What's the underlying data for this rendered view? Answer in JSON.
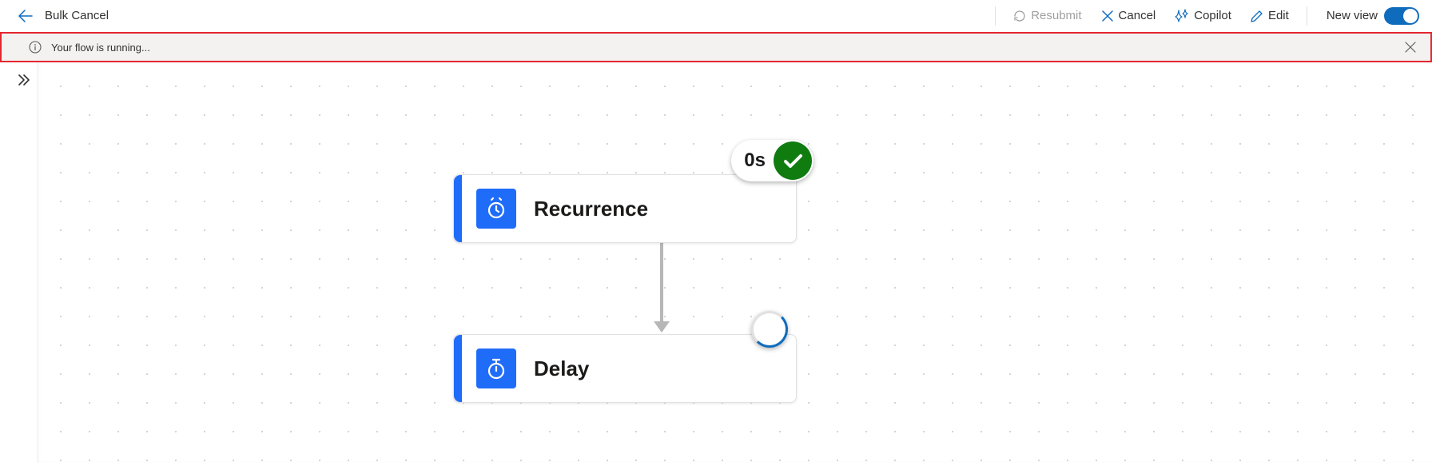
{
  "header": {
    "title": "Bulk Cancel",
    "resubmit": "Resubmit",
    "cancel": "Cancel",
    "copilot": "Copilot",
    "edit": "Edit",
    "newview": "New view"
  },
  "notification": {
    "message": "Your flow is running..."
  },
  "flow": {
    "step1": {
      "title": "Recurrence",
      "badge_time": "0s"
    },
    "step2": {
      "title": "Delay"
    }
  }
}
